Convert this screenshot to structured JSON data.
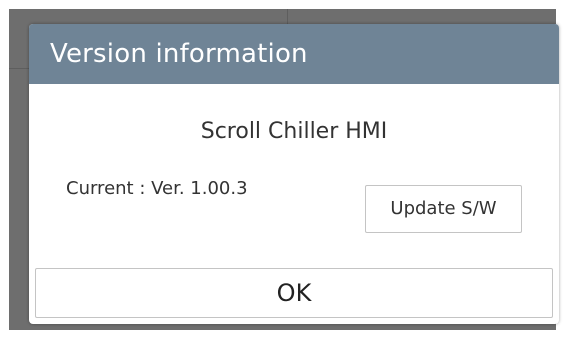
{
  "dialog": {
    "title": "Version information",
    "app_name": "Scroll Chiller HMI",
    "current_label": "Current",
    "separator": " : ",
    "version_value": "Ver. 1.00.3",
    "update_button_label": "Update S/W",
    "ok_button_label": "OK"
  },
  "colors": {
    "header_bg": "#6f8496",
    "backdrop": "#6e6e6e",
    "text": "#333333"
  }
}
